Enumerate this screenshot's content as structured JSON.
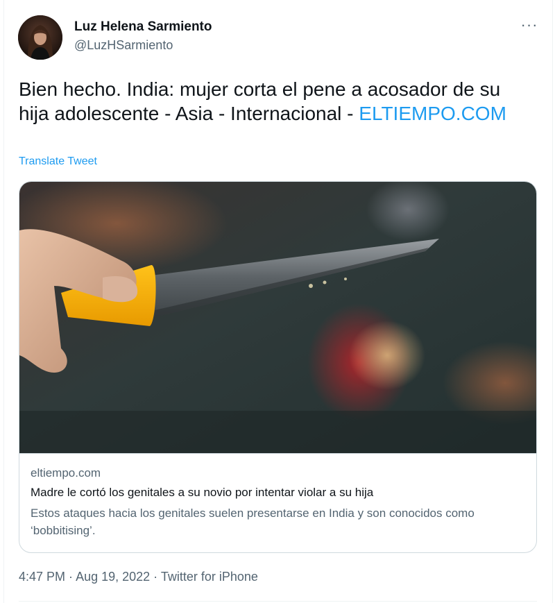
{
  "author": {
    "name": "Luz Helena Sarmiento",
    "handle": "@LuzHSarmiento"
  },
  "more_icon": "more-horizontal-icon",
  "tweet": {
    "text": "Bien hecho. India: mujer corta el pene a acosador de su hija adolescente - Asia - Internacional - ",
    "link_text": "ELTIEMPO.COM",
    "translate_label": "Translate Tweet"
  },
  "card": {
    "domain": "eltiempo.com",
    "title": "Madre le cortó los genitales a su novio por intentar violar a su hija",
    "description": "Estos ataques hacia los genitales suelen presentarse en India y son conocidos como ‘bobbitising’."
  },
  "meta": {
    "time": "4:47 PM",
    "separator": " · ",
    "date": "Aug 19, 2022",
    "source": "Twitter for iPhone"
  },
  "colors": {
    "link": "#1d9bf0",
    "secondary_text": "#536471",
    "primary_text": "#0f1419",
    "border": "#cfd9de"
  }
}
